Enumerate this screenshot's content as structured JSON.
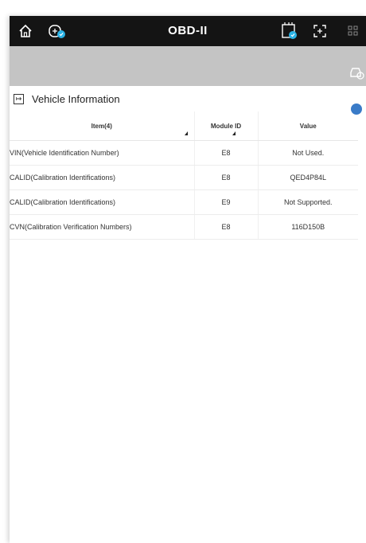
{
  "header": {
    "title": "OBD-II",
    "icons": [
      "home-icon",
      "vci-connection-icon",
      "diagnostic-report-icon",
      "screenshot-icon",
      "menu-grid-icon"
    ]
  },
  "section": {
    "title": "Vehicle Information",
    "icon": "exit-icon"
  },
  "table": {
    "headers": {
      "item": "Item(4)",
      "module_id": "Module ID",
      "value": "Value"
    },
    "rows": [
      {
        "item": "VIN(Vehicle Identification Number)",
        "module_id": "E8",
        "value": "Not Used."
      },
      {
        "item": "CALID(Calibration Identifications)",
        "module_id": "E8",
        "value": "QED4P84L"
      },
      {
        "item": "CALID(Calibration Identifications)",
        "module_id": "E9",
        "value": "Not Supported."
      },
      {
        "item": "CVN(Calibration Verification Numbers)",
        "module_id": "E8",
        "value": "116D150B"
      }
    ]
  },
  "colors": {
    "topbar": "#141414",
    "subbar": "#c4c4c4",
    "accent_dot": "#3a7bc8"
  }
}
